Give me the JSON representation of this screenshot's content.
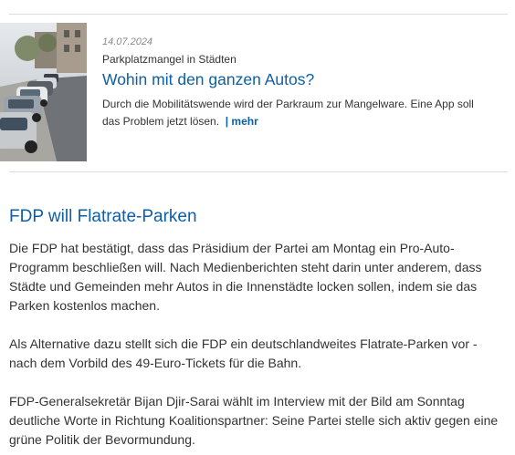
{
  "teaser": {
    "date": "14.07.2024",
    "kicker": "Parkplatzmangel in Städten",
    "headline": "Wohin mit den ganzen Autos?",
    "summary": "Durch die Mobilitätswende wird der Parkraum zur Mangelware. Eine App soll das Problem jetzt lösen.",
    "more_label": "| mehr",
    "image_icon": "parked-cars-photo"
  },
  "article": {
    "title": "FDP will Flatrate-Parken",
    "paragraphs": [
      "Die FDP hat bestätigt, dass das Präsidium der Partei am Montag ein Pro-Auto-Programm beschließen will. Nach Medienberichten steht darin unter anderem, dass Städte und Gemeinden mehr Autos in die Innenstädte locken sollen, indem sie das Parken kostenlos machen.",
      "Als Alternative dazu stellt sich die FDP ein deutschlandweites Flatrate-Parken vor - nach dem Vorbild des 49-Euro-Tickets für die Bahn.",
      "FDP-Generalsekretär Bijan Djir-Sarai wählt im Interview mit der Bild am Sonntag deutliche Worte in Richtung Koalitionspartner: Seine Partei stelle sich aktiv gegen eine grüne Politik der Bevormundung."
    ]
  },
  "colors": {
    "link_blue": "#0d5fa6",
    "text": "#333333",
    "date_gray": "#8a8a8a",
    "divider": "#dcdcdc"
  }
}
